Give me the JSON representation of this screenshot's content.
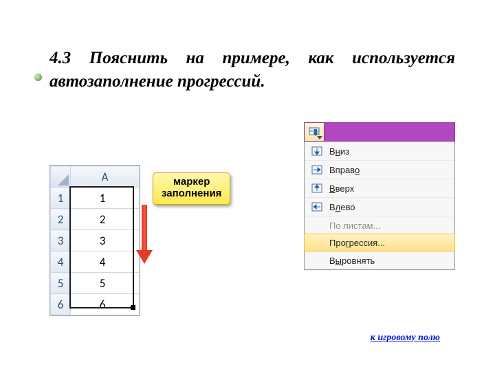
{
  "heading": "4.3 Пояснить на примере, как используется автозаполнение прогрессий.",
  "callout": {
    "line1": "маркер",
    "line2": "заполнения"
  },
  "spreadsheet": {
    "col_header": "A",
    "rows": [
      {
        "n": "1",
        "v": "1"
      },
      {
        "n": "2",
        "v": "2"
      },
      {
        "n": "3",
        "v": "3"
      },
      {
        "n": "4",
        "v": "4"
      },
      {
        "n": "5",
        "v": "5"
      },
      {
        "n": "6",
        "v": "6"
      }
    ]
  },
  "menu": {
    "items": [
      {
        "pre": "В",
        "u": "н",
        "post": "из",
        "type": "down"
      },
      {
        "pre": "Вправ",
        "u": "о",
        "post": "",
        "type": "right"
      },
      {
        "pre": "",
        "u": "В",
        "post": "верх",
        "type": "up"
      },
      {
        "pre": "В",
        "u": "л",
        "post": "ево",
        "type": "left"
      },
      {
        "pre": "По листам...",
        "u": "",
        "post": "",
        "type": "none",
        "disabled": true
      },
      {
        "pre": "Про",
        "u": "г",
        "post": "рессия...",
        "type": "none",
        "hl": true
      },
      {
        "pre": "В",
        "u": "ы",
        "post": "ровнять",
        "type": "none"
      }
    ]
  },
  "link": "к игровому полю"
}
